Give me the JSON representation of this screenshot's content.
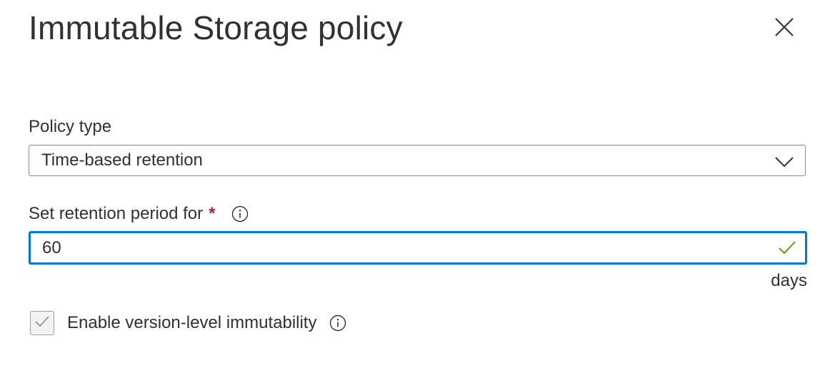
{
  "panel": {
    "title": "Immutable Storage policy",
    "close_icon": "close-icon"
  },
  "policy_type": {
    "label": "Policy type",
    "selected": "Time-based retention",
    "chevron_icon": "chevron-down-icon"
  },
  "retention": {
    "label": "Set retention period for",
    "required_mark": "*",
    "info_icon": "info-icon",
    "value": "60",
    "valid_icon": "checkmark-icon",
    "suffix": "days"
  },
  "version_immutability": {
    "label": "Enable version-level immutability",
    "checked": true,
    "info_icon": "info-icon"
  },
  "colors": {
    "accent": "#0078d4",
    "valid": "#57a300",
    "required": "#a4262c",
    "text": "#323130"
  }
}
